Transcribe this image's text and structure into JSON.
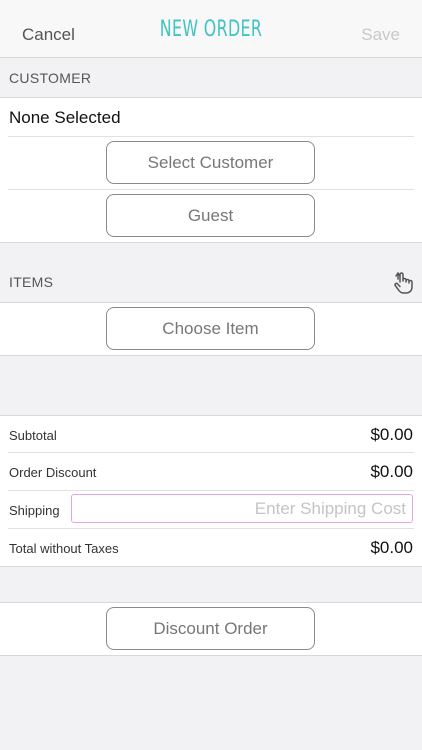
{
  "nav": {
    "cancel": "Cancel",
    "title": "NEW ORDER",
    "save": "Save"
  },
  "customer": {
    "header": "CUSTOMER",
    "selected": "None Selected",
    "select_button": "Select Customer",
    "guest_button": "Guest"
  },
  "items": {
    "header": "ITEMS",
    "icon": "hand-pointer-icon",
    "choose_button": "Choose Item"
  },
  "totals": {
    "subtotal_label": "Subtotal",
    "subtotal_value": "$0.00",
    "discount_label": "Order Discount",
    "discount_value": "$0.00",
    "shipping_label": "Shipping",
    "shipping_placeholder": "Enter Shipping Cost",
    "total_label": "Total without Taxes",
    "total_value": "$0.00"
  },
  "discount_button": "Discount Order",
  "colors": {
    "accent": "#3fc3c3",
    "input_border": "#e6a6e6"
  }
}
